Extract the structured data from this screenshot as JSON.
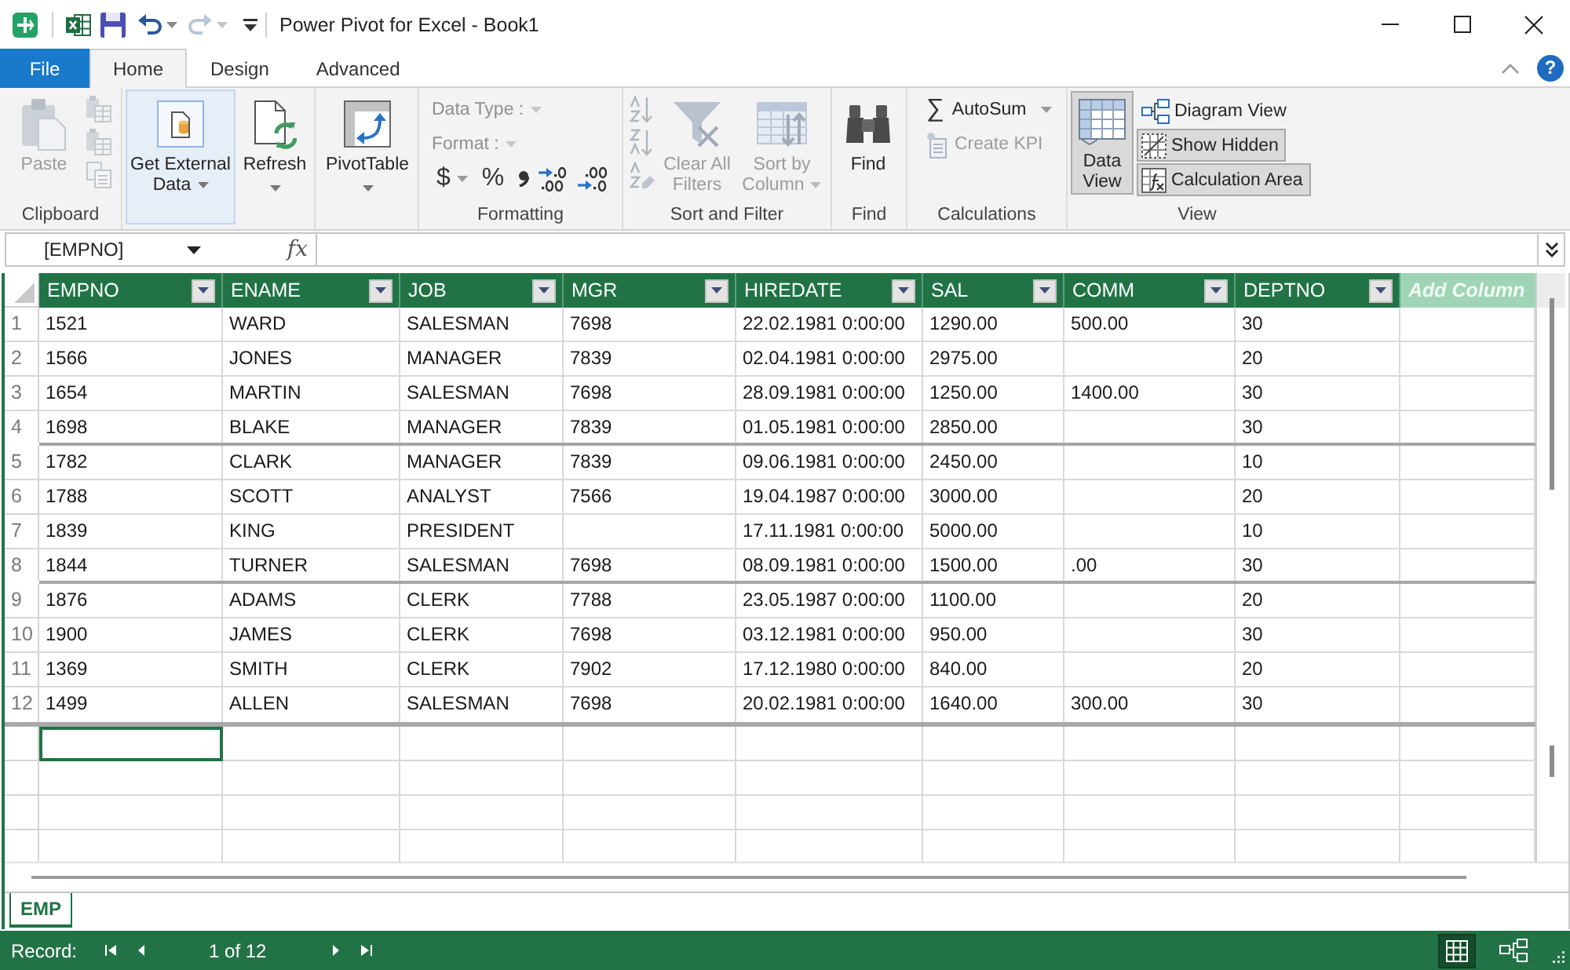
{
  "window": {
    "title": "Power Pivot for Excel - Book1"
  },
  "quick_access": {
    "undo_disabled": false,
    "redo_disabled": true
  },
  "ribbon_tabs": [
    {
      "label": "File",
      "kind": "file",
      "selected": false
    },
    {
      "label": "Home",
      "kind": "tab",
      "selected": true
    },
    {
      "label": "Design",
      "kind": "tab",
      "selected": false
    },
    {
      "label": "Advanced",
      "kind": "tab",
      "selected": false
    }
  ],
  "help_button": "?",
  "ribbon_groups": [
    {
      "label": "Clipboard",
      "buttons": [
        {
          "label": "Paste",
          "disabled": true
        },
        {
          "disabled": true
        },
        {
          "disabled": true
        },
        {
          "disabled": true
        }
      ]
    },
    {
      "buttons": [
        {
          "label": "Get External Data",
          "dropdown": true,
          "highlighted": true
        },
        {
          "label": "Refresh",
          "dropdown": true,
          "highlighted": false
        }
      ]
    },
    {
      "buttons": [
        {
          "label": "PivotTable",
          "dropdown": true
        }
      ]
    },
    {
      "label": "Formatting",
      "dropdowns": [
        {
          "label": "Data Type :",
          "disabled": true
        },
        {
          "label": "Format :",
          "disabled": true
        }
      ],
      "buttons": [
        {
          "symbol": "$",
          "dropdown": true
        },
        {
          "symbol": "%",
          "dropdown": false
        }
      ]
    },
    {
      "label": "Sort and Filter",
      "buttons": [
        {
          "disabled": true
        },
        {
          "disabled": true
        },
        {
          "disabled": true
        },
        {
          "label": "Clear All Filters",
          "disabled": true,
          "dropdown": false
        },
        {
          "label": "Sort by Column",
          "disabled": true,
          "dropdown": true
        }
      ]
    },
    {
      "label": "Find",
      "buttons": [
        {
          "label": "Find",
          "disabled": false
        }
      ]
    },
    {
      "label": "Calculations",
      "buttons": [
        {
          "symbol": "∑",
          "label": "AutoSum",
          "dropdown": true,
          "disabled": false
        },
        {
          "label": "Create KPI",
          "dropdown": false,
          "disabled": true
        }
      ]
    },
    {
      "label": "View",
      "buttons": [
        {
          "label": "Data View",
          "selected": true
        },
        {
          "label": "Diagram View",
          "selected": false
        },
        {
          "label": "Show Hidden",
          "selected": true
        },
        {
          "label": "Calculation Area",
          "selected": true
        }
      ]
    }
  ],
  "formula_bar": {
    "name_box": "[EMPNO]",
    "function_label": "fx"
  },
  "table": {
    "columns": [
      {
        "label": "EMPNO",
        "selected": true
      },
      {
        "label": "ENAME",
        "selected": false
      },
      {
        "label": "JOB",
        "selected": false
      },
      {
        "label": "MGR",
        "selected": false
      },
      {
        "label": "HIREDATE",
        "selected": false
      },
      {
        "label": "SAL",
        "selected": false
      },
      {
        "label": "COMM",
        "selected": false
      },
      {
        "label": "DEPTNO",
        "selected": false
      }
    ],
    "add_column": "Add Column",
    "rows": [
      {
        "number": "1",
        "break_after": false,
        "cells": [
          "1521",
          "WARD",
          "SALESMAN",
          "7698",
          "22.02.1981 0:00:00",
          "1290.00",
          "500.00",
          "30"
        ]
      },
      {
        "number": "2",
        "break_after": false,
        "cells": [
          "1566",
          "JONES",
          "MANAGER",
          "7839",
          "02.04.1981 0:00:00",
          "2975.00",
          null,
          "20"
        ]
      },
      {
        "number": "3",
        "break_after": false,
        "cells": [
          "1654",
          "MARTIN",
          "SALESMAN",
          "7698",
          "28.09.1981 0:00:00",
          "1250.00",
          "1400.00",
          "30"
        ]
      },
      {
        "number": "4",
        "break_after": true,
        "cells": [
          "1698",
          "BLAKE",
          "MANAGER",
          "7839",
          "01.05.1981 0:00:00",
          "2850.00",
          null,
          "30"
        ]
      },
      {
        "number": "5",
        "break_after": false,
        "cells": [
          "1782",
          "CLARK",
          "MANAGER",
          "7839",
          "09.06.1981 0:00:00",
          "2450.00",
          null,
          "10"
        ]
      },
      {
        "number": "6",
        "break_after": false,
        "cells": [
          "1788",
          "SCOTT",
          "ANALYST",
          "7566",
          "19.04.1987 0:00:00",
          "3000.00",
          null,
          "20"
        ]
      },
      {
        "number": "7",
        "break_after": false,
        "cells": [
          "1839",
          "KING",
          "PRESIDENT",
          null,
          "17.11.1981 0:00:00",
          "5000.00",
          null,
          "10"
        ]
      },
      {
        "number": "8",
        "break_after": true,
        "cells": [
          "1844",
          "TURNER",
          "SALESMAN",
          "7698",
          "08.09.1981 0:00:00",
          "1500.00",
          ".00",
          "30"
        ]
      },
      {
        "number": "9",
        "break_after": false,
        "cells": [
          "1876",
          "ADAMS",
          "CLERK",
          "7788",
          "23.05.1987 0:00:00",
          "1100.00",
          null,
          "20"
        ]
      },
      {
        "number": "10",
        "break_after": false,
        "cells": [
          "1900",
          "JAMES",
          "CLERK",
          "7698",
          "03.12.1981 0:00:00",
          "950.00",
          null,
          "30"
        ]
      },
      {
        "number": "11",
        "break_after": false,
        "cells": [
          "1369",
          "SMITH",
          "CLERK",
          "7902",
          "17.12.1980 0:00:00",
          "840.00",
          null,
          "20"
        ]
      },
      {
        "number": "12",
        "break_after": false,
        "cells": [
          "1499",
          "ALLEN",
          "SALESMAN",
          "7698",
          "20.02.1981 0:00:00",
          "1640.00",
          "300.00",
          "30"
        ]
      }
    ]
  },
  "sheet_tabs": [
    {
      "label": "EMP",
      "selected": true
    }
  ],
  "status_bar": {
    "record_label": "Record:",
    "position": "1 of 12",
    "views": [
      {
        "selected": true
      },
      {
        "selected": false
      }
    ]
  }
}
